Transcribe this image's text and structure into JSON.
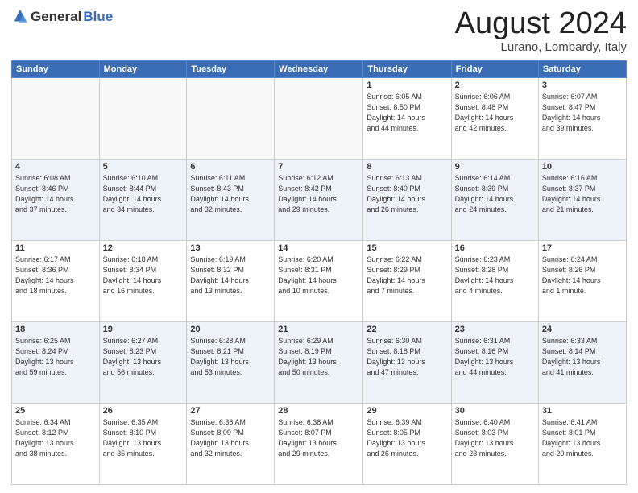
{
  "header": {
    "logo_general": "General",
    "logo_blue": "Blue",
    "month": "August 2024",
    "location": "Lurano, Lombardy, Italy"
  },
  "weekdays": [
    "Sunday",
    "Monday",
    "Tuesday",
    "Wednesday",
    "Thursday",
    "Friday",
    "Saturday"
  ],
  "weeks": [
    [
      {
        "day": "",
        "info": ""
      },
      {
        "day": "",
        "info": ""
      },
      {
        "day": "",
        "info": ""
      },
      {
        "day": "",
        "info": ""
      },
      {
        "day": "1",
        "info": "Sunrise: 6:05 AM\nSunset: 8:50 PM\nDaylight: 14 hours\nand 44 minutes."
      },
      {
        "day": "2",
        "info": "Sunrise: 6:06 AM\nSunset: 8:48 PM\nDaylight: 14 hours\nand 42 minutes."
      },
      {
        "day": "3",
        "info": "Sunrise: 6:07 AM\nSunset: 8:47 PM\nDaylight: 14 hours\nand 39 minutes."
      }
    ],
    [
      {
        "day": "4",
        "info": "Sunrise: 6:08 AM\nSunset: 8:46 PM\nDaylight: 14 hours\nand 37 minutes."
      },
      {
        "day": "5",
        "info": "Sunrise: 6:10 AM\nSunset: 8:44 PM\nDaylight: 14 hours\nand 34 minutes."
      },
      {
        "day": "6",
        "info": "Sunrise: 6:11 AM\nSunset: 8:43 PM\nDaylight: 14 hours\nand 32 minutes."
      },
      {
        "day": "7",
        "info": "Sunrise: 6:12 AM\nSunset: 8:42 PM\nDaylight: 14 hours\nand 29 minutes."
      },
      {
        "day": "8",
        "info": "Sunrise: 6:13 AM\nSunset: 8:40 PM\nDaylight: 14 hours\nand 26 minutes."
      },
      {
        "day": "9",
        "info": "Sunrise: 6:14 AM\nSunset: 8:39 PM\nDaylight: 14 hours\nand 24 minutes."
      },
      {
        "day": "10",
        "info": "Sunrise: 6:16 AM\nSunset: 8:37 PM\nDaylight: 14 hours\nand 21 minutes."
      }
    ],
    [
      {
        "day": "11",
        "info": "Sunrise: 6:17 AM\nSunset: 8:36 PM\nDaylight: 14 hours\nand 18 minutes."
      },
      {
        "day": "12",
        "info": "Sunrise: 6:18 AM\nSunset: 8:34 PM\nDaylight: 14 hours\nand 16 minutes."
      },
      {
        "day": "13",
        "info": "Sunrise: 6:19 AM\nSunset: 8:32 PM\nDaylight: 14 hours\nand 13 minutes."
      },
      {
        "day": "14",
        "info": "Sunrise: 6:20 AM\nSunset: 8:31 PM\nDaylight: 14 hours\nand 10 minutes."
      },
      {
        "day": "15",
        "info": "Sunrise: 6:22 AM\nSunset: 8:29 PM\nDaylight: 14 hours\nand 7 minutes."
      },
      {
        "day": "16",
        "info": "Sunrise: 6:23 AM\nSunset: 8:28 PM\nDaylight: 14 hours\nand 4 minutes."
      },
      {
        "day": "17",
        "info": "Sunrise: 6:24 AM\nSunset: 8:26 PM\nDaylight: 14 hours\nand 1 minute."
      }
    ],
    [
      {
        "day": "18",
        "info": "Sunrise: 6:25 AM\nSunset: 8:24 PM\nDaylight: 13 hours\nand 59 minutes."
      },
      {
        "day": "19",
        "info": "Sunrise: 6:27 AM\nSunset: 8:23 PM\nDaylight: 13 hours\nand 56 minutes."
      },
      {
        "day": "20",
        "info": "Sunrise: 6:28 AM\nSunset: 8:21 PM\nDaylight: 13 hours\nand 53 minutes."
      },
      {
        "day": "21",
        "info": "Sunrise: 6:29 AM\nSunset: 8:19 PM\nDaylight: 13 hours\nand 50 minutes."
      },
      {
        "day": "22",
        "info": "Sunrise: 6:30 AM\nSunset: 8:18 PM\nDaylight: 13 hours\nand 47 minutes."
      },
      {
        "day": "23",
        "info": "Sunrise: 6:31 AM\nSunset: 8:16 PM\nDaylight: 13 hours\nand 44 minutes."
      },
      {
        "day": "24",
        "info": "Sunrise: 6:33 AM\nSunset: 8:14 PM\nDaylight: 13 hours\nand 41 minutes."
      }
    ],
    [
      {
        "day": "25",
        "info": "Sunrise: 6:34 AM\nSunset: 8:12 PM\nDaylight: 13 hours\nand 38 minutes."
      },
      {
        "day": "26",
        "info": "Sunrise: 6:35 AM\nSunset: 8:10 PM\nDaylight: 13 hours\nand 35 minutes."
      },
      {
        "day": "27",
        "info": "Sunrise: 6:36 AM\nSunset: 8:09 PM\nDaylight: 13 hours\nand 32 minutes."
      },
      {
        "day": "28",
        "info": "Sunrise: 6:38 AM\nSunset: 8:07 PM\nDaylight: 13 hours\nand 29 minutes."
      },
      {
        "day": "29",
        "info": "Sunrise: 6:39 AM\nSunset: 8:05 PM\nDaylight: 13 hours\nand 26 minutes."
      },
      {
        "day": "30",
        "info": "Sunrise: 6:40 AM\nSunset: 8:03 PM\nDaylight: 13 hours\nand 23 minutes."
      },
      {
        "day": "31",
        "info": "Sunrise: 6:41 AM\nSunset: 8:01 PM\nDaylight: 13 hours\nand 20 minutes."
      }
    ]
  ]
}
